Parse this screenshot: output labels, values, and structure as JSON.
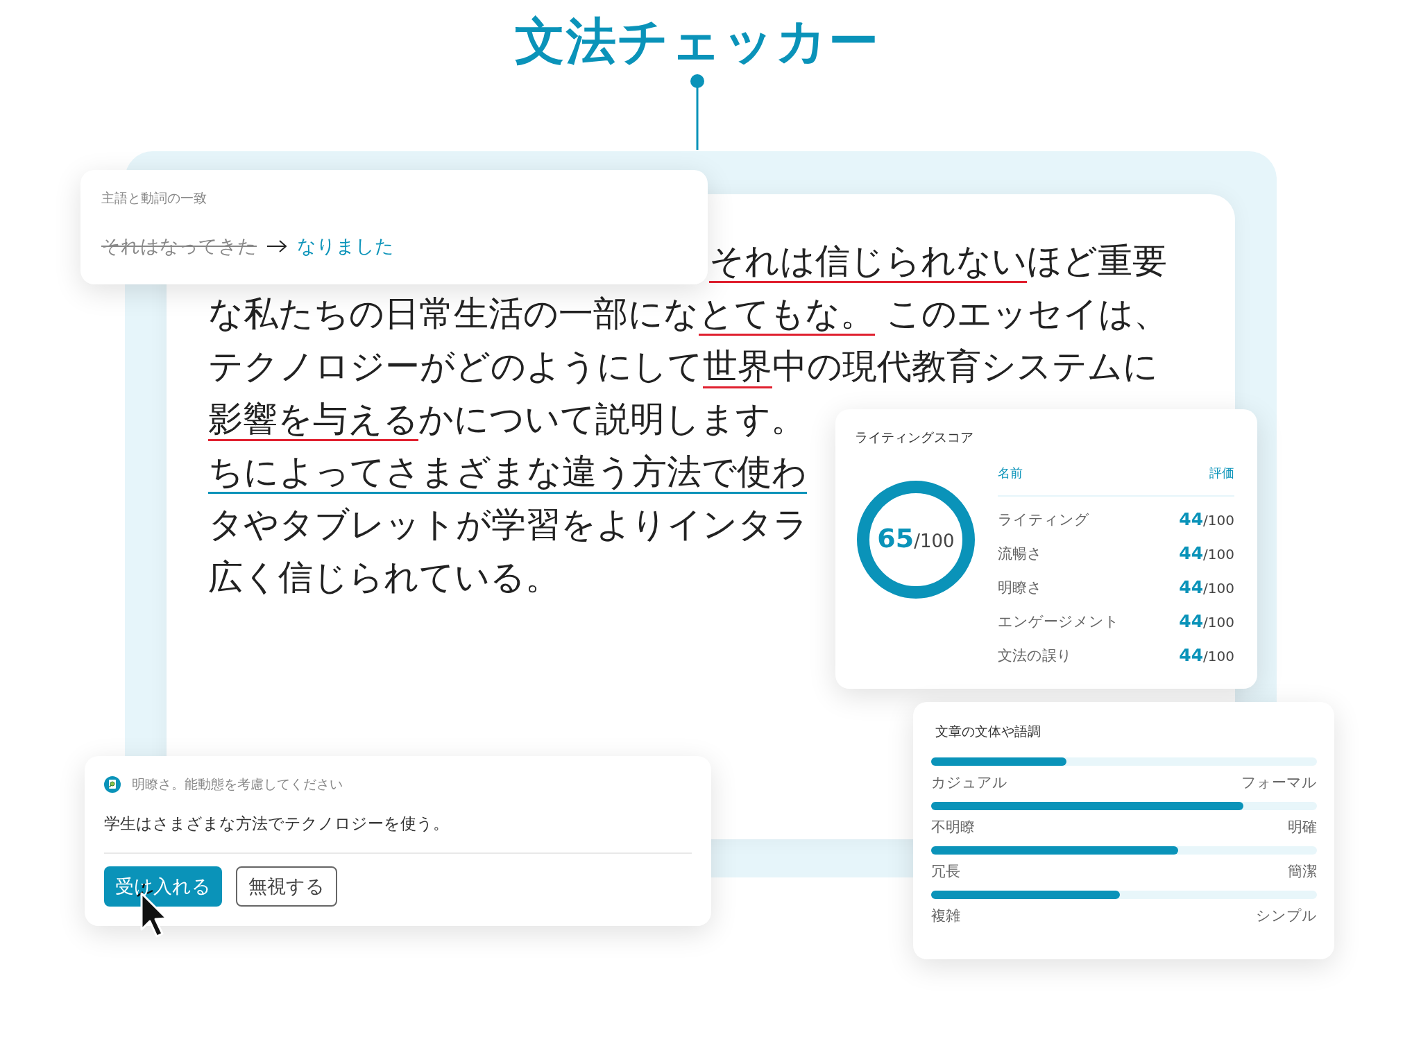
{
  "title": "文法チェッカー",
  "essay": {
    "lines": [
      [
        {
          "text": "それは信じられない",
          "color": "#e0202f"
        },
        {
          "text": "ほど重要"
        }
      ],
      [
        {
          "text": "な私たちの日常生活の一部にな"
        },
        {
          "text": "とてもな。",
          "color": "#e0202f"
        },
        {
          "text": " このエッセイは、"
        }
      ],
      [
        {
          "text": "テクノロジーがどのようにして"
        },
        {
          "text": "世界",
          "color": "#e0202f"
        },
        {
          "text": "中の現代教育システムに"
        }
      ],
      [
        {
          "text": "影響を与える",
          "color": "#e0202f"
        },
        {
          "text": "かについて説明します。"
        }
      ],
      [
        {
          "text": "ちによってさまざまな違う方法で使わ",
          "color": "#0a93b9"
        }
      ],
      [
        {
          "text": "タやタブレットが学習をよりインタラ"
        }
      ],
      [
        {
          "text": "広く信じられている。"
        }
      ]
    ]
  },
  "correction": {
    "title": "主語と動詞の一致",
    "original": "それはなってきた",
    "suggestion": "なりました"
  },
  "score": {
    "title": "ライティングスコア",
    "total": "**65**/100",
    "columns": [
      "名前",
      "評価"
    ],
    "rows": [
      {
        "name": "ライティング",
        "value": "**44**/100"
      },
      {
        "name": "流暢さ",
        "value": "**44**/100"
      },
      {
        "name": "明瞭さ",
        "value": "**44**/100"
      },
      {
        "name": "エンゲージメント",
        "value": "**44**/100"
      },
      {
        "name": "文法の誤り",
        "value": "**44**/100"
      }
    ]
  },
  "tone": {
    "title": "文章の文体や語調",
    "scales": [
      {
        "left": "カジュアル",
        "right": "フォーマル",
        "level": 0.35
      },
      {
        "left": "不明瞭",
        "right": "明確",
        "level": 0.81
      },
      {
        "left": "冗長",
        "right": "簡潔",
        "level": 0.64
      },
      {
        "left": "複雑",
        "right": "シンプル",
        "level": 0.49
      }
    ]
  },
  "suggestion": {
    "hint": "明瞭さ。能動態を考慮してください",
    "sentence": "学生はさまざまな方法でテクノロジーを使う。",
    "buttons": [
      {
        "label": "受け入れる",
        "kind": "primary"
      },
      {
        "label": "無視する",
        "kind": "secondary"
      }
    ]
  }
}
